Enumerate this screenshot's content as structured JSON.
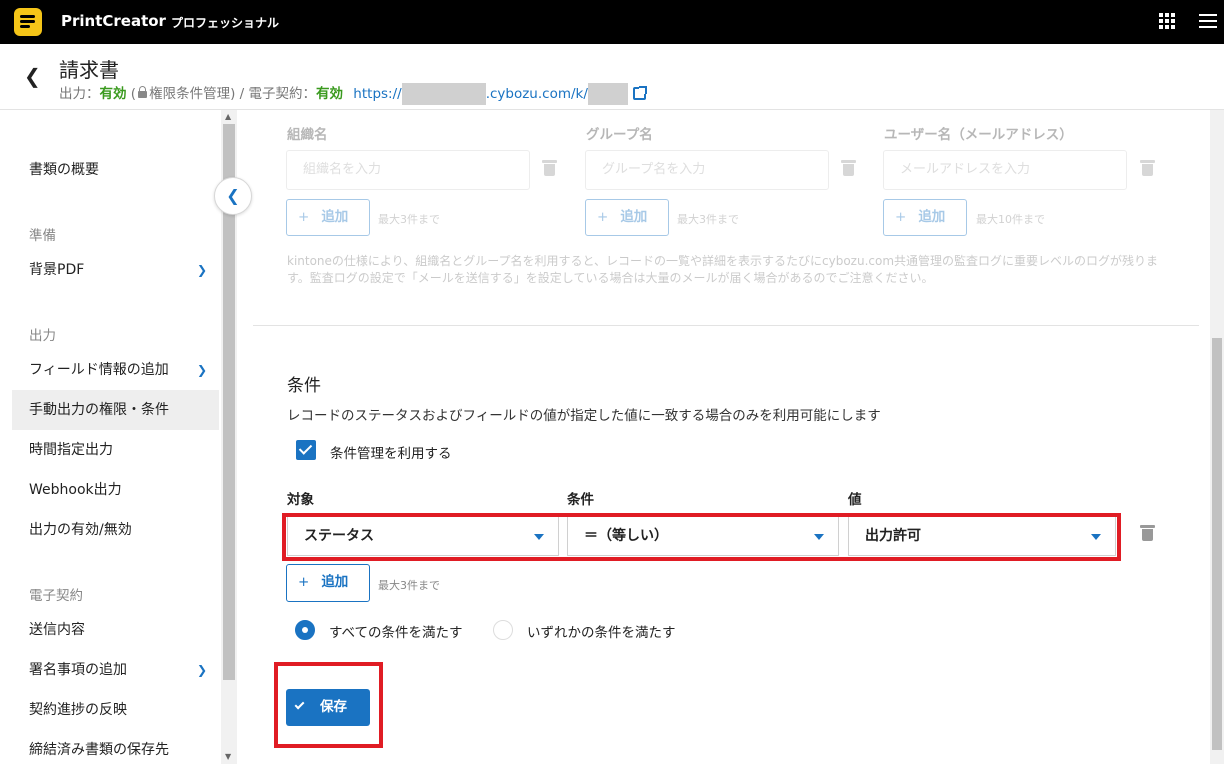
{
  "app": {
    "name": "PrintCreator",
    "edition": "プロフェッショナル"
  },
  "header": {
    "title": "請求書",
    "output_label": "出力：",
    "output_status": "有効",
    "permission_note": "権限条件管理)",
    "paren_open": "(",
    "esign_label": " / 電子契約：",
    "esign_status": "有効",
    "url_prefix": "https://",
    "url_mid": ".cybozu.com/k/"
  },
  "sidebar": {
    "items": [
      {
        "label": "書類の概要"
      },
      {
        "label": "背景PDF"
      },
      {
        "label": "フィールド情報の追加"
      },
      {
        "label": "手動出力の権限・条件"
      },
      {
        "label": "時間指定出力"
      },
      {
        "label": "Webhook出力"
      },
      {
        "label": "出力の有効/無効"
      },
      {
        "label": "送信内容"
      },
      {
        "label": "署名事項の追加"
      },
      {
        "label": "契約進捗の反映"
      },
      {
        "label": "締結済み書類の保存先"
      }
    ],
    "sections": [
      "準備",
      "出力",
      "電子契約"
    ]
  },
  "permissions": {
    "org_label": "組織名",
    "org_placeholder": "組織名を入力",
    "group_label": "グループ名",
    "group_placeholder": "グループ名を入力",
    "user_label": "ユーザー名（メールアドレス）",
    "user_placeholder": "メールアドレスを入力",
    "add_label": "追加",
    "org_limit": "最大3件まで",
    "group_limit": "最大3件まで",
    "user_limit": "最大10件まで",
    "note": "kintoneの仕様により、組織名とグループ名を利用すると、レコードの一覧や詳細を表示するたびにcybozu.com共通管理の監査ログに重要レベルのログが残ります。監査ログの設定で「メールを送信する」を設定している場合は大量のメールが届く場合があるのでご注意ください。"
  },
  "conditions": {
    "title": "条件",
    "description": "レコードのステータスおよびフィールドの値が指定した値に一致する場合のみを利用可能にします",
    "use_checkbox_label": "条件管理を利用する",
    "use_checked": true,
    "columns": {
      "target": "対象",
      "condition": "条件",
      "value": "値"
    },
    "row": {
      "target": "ステータス",
      "condition": "＝（等しい）",
      "value": "出力許可"
    },
    "add_label": "追加",
    "limit": "最大3件まで",
    "match_all_label": "すべての条件を満たす",
    "match_any_label": "いずれかの条件を満たす",
    "selected_match": "all"
  },
  "save_label": "保存",
  "colors": {
    "accent": "#1a73c2",
    "ok": "#3a9a1e",
    "highlight": "#e01c24",
    "topbar": "#000000",
    "logo": "#f5c518"
  }
}
